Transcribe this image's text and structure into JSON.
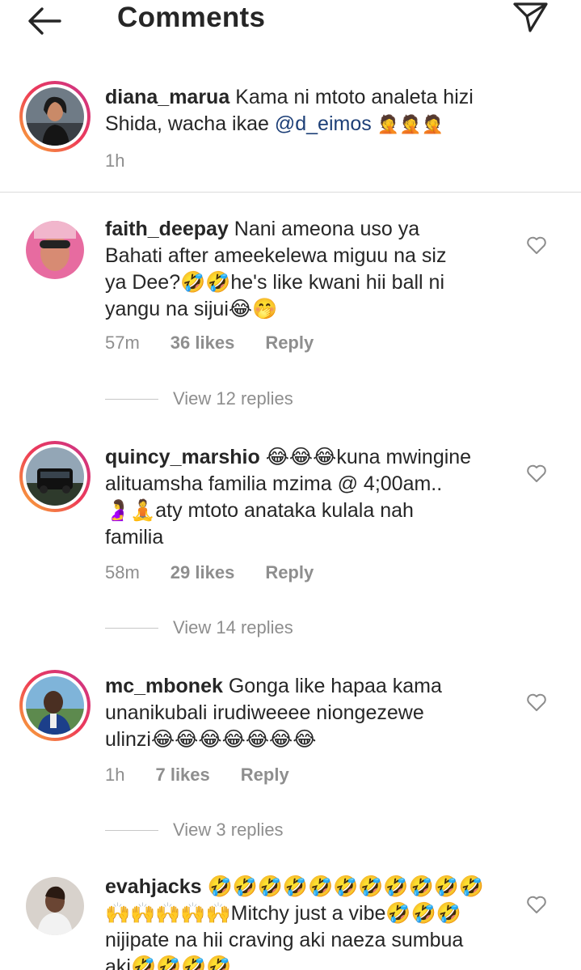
{
  "header": {
    "title": "Comments"
  },
  "caption": {
    "username": "diana_marua",
    "text_line1": "Kama ni mtoto analeta hizi",
    "text_line2_prefix": "Shida, wacha ikae ",
    "mention": "@d_eimos",
    "emojis": "🤦🤦🤦",
    "time": "1h"
  },
  "comments": [
    {
      "username": "faith_deepay",
      "lines": [
        "Nani ameona uso ya",
        "Bahati after ameekelewa miguu na siz",
        "ya Dee?🤣🤣he's like kwani hii ball ni",
        "yangu na sijui😂🤭"
      ],
      "time": "57m",
      "likes": "36 likes",
      "reply": "Reply",
      "view_replies": "View 12 replies"
    },
    {
      "username": "quincy_marshio",
      "lines": [
        "😂😂😂kuna mwingine",
        "alituamsha familia mzima @ 4;00am..",
        "🤰🧘aty mtoto anataka kulala nah",
        "familia"
      ],
      "time": "58m",
      "likes": "29 likes",
      "reply": "Reply",
      "view_replies": "View 14 replies"
    },
    {
      "username": "mc_mbonek",
      "lines": [
        "Gonga like hapaa kama",
        "unanikubali irudiweeee niongezewe",
        "ulinzi😂😂😂😂😂😂😂"
      ],
      "time": "1h",
      "likes": "7 likes",
      "reply": "Reply",
      "view_replies": "View 3 replies"
    },
    {
      "username": "evahjacks",
      "lines": [
        "🤣🤣🤣🤣🤣🤣🤣🤣🤣🤣🤣",
        "🙌🙌🙌🙌🙌Mitchy just a vibe🤣🤣🤣",
        "nijipate na hii craving aki naeza sumbua",
        "aki🤣🤣🤣🤣"
      ]
    }
  ],
  "colors": {
    "text": "#262626",
    "secondary": "#8e8e8e",
    "mention": "#1d3f77",
    "story_ring_start": "#f9b234",
    "story_ring_end": "#c8348d"
  },
  "icons": {
    "back": "arrow-left-icon",
    "send": "paper-plane-icon",
    "like": "heart-outline-icon"
  }
}
